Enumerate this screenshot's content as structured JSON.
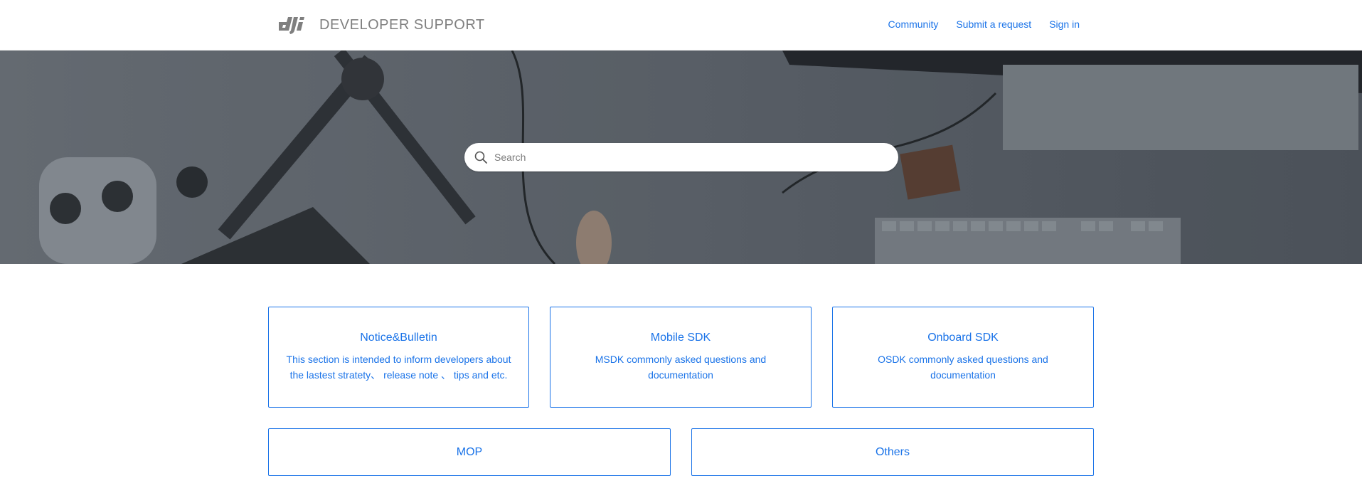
{
  "header": {
    "logo_icon": "dji-logo-icon",
    "brand_title": "DEVELOPER SUPPORT",
    "nav": [
      {
        "label": "Community"
      },
      {
        "label": "Submit a request"
      },
      {
        "label": "Sign in"
      }
    ]
  },
  "search": {
    "placeholder": "Search",
    "icon": "search-icon"
  },
  "categories": [
    {
      "title": "Notice&Bulletin",
      "description": "This section is intended to inform developers about the lastest stratety、 release note 、 tips and etc."
    },
    {
      "title": "Mobile SDK",
      "description": "MSDK commonly asked questions and documentation"
    },
    {
      "title": "Onboard SDK",
      "description": "OSDK commonly asked questions and documentation"
    },
    {
      "title": "MOP"
    },
    {
      "title": "Others"
    }
  ],
  "colors": {
    "accent": "#1a73e8",
    "brand_gray": "#7f7f7f"
  }
}
